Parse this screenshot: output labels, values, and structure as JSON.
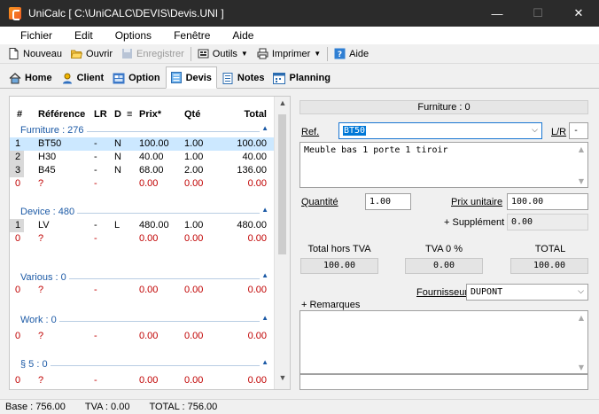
{
  "window": {
    "title": "UniCalc [ C:\\UniCALC\\DEVIS\\Devis.UNI ]",
    "minimize": "—",
    "maximize": "☐",
    "close": "✕"
  },
  "menu": [
    "Fichier",
    "Edit",
    "Options",
    "Fenêtre",
    "Aide"
  ],
  "toolbar": {
    "nouveau": "Nouveau",
    "ouvrir": "Ouvrir",
    "enregistrer": "Enregistrer",
    "outils": "Outils",
    "imprimer": "Imprimer",
    "aide": "Aide"
  },
  "tabs": [
    "Home",
    "Client",
    "Option",
    "Devis",
    "Notes",
    "Planning"
  ],
  "active_tab": "Devis",
  "grid": {
    "headers": {
      "num": "#",
      "ref": "Référence",
      "lr": "LR",
      "d": "D",
      "u": "≡",
      "prix": "Prix*",
      "qte": "Qté",
      "total": "Total"
    },
    "groups": [
      {
        "name": "Furniture : 276",
        "rows": [
          {
            "num": "1",
            "ref": "BT50",
            "lr": "-",
            "d": "N",
            "prix": "100.00",
            "qte": "1.00",
            "total": "100.00",
            "selected": true
          },
          {
            "num": "2",
            "ref": "H30",
            "lr": "-",
            "d": "N",
            "prix": "40.00",
            "qte": "1.00",
            "total": "40.00"
          },
          {
            "num": "3",
            "ref": "B45",
            "lr": "-",
            "d": "N",
            "prix": "68.00",
            "qte": "2.00",
            "total": "136.00"
          },
          {
            "num": "0",
            "ref": "?",
            "lr": "-",
            "d": "",
            "prix": "0.00",
            "qte": "0.00",
            "total": "0.00",
            "new": true
          }
        ]
      },
      {
        "name": "Device : 480",
        "rows": [
          {
            "num": "1",
            "ref": "LV",
            "lr": "-",
            "d": "L",
            "prix": "480.00",
            "qte": "1.00",
            "total": "480.00"
          },
          {
            "num": "0",
            "ref": "?",
            "lr": "-",
            "d": "",
            "prix": "0.00",
            "qte": "0.00",
            "total": "0.00",
            "new": true
          }
        ]
      },
      {
        "name": "Various : 0",
        "rows": [
          {
            "num": "0",
            "ref": "?",
            "lr": "-",
            "d": "",
            "prix": "0.00",
            "qte": "0.00",
            "total": "0.00",
            "new": true
          }
        ]
      },
      {
        "name": "Work : 0",
        "rows": [
          {
            "num": "0",
            "ref": "?",
            "lr": "-",
            "d": "",
            "prix": "0.00",
            "qte": "0.00",
            "total": "0.00",
            "new": true
          }
        ]
      },
      {
        "name": "§ 5 : 0",
        "rows": [
          {
            "num": "0",
            "ref": "?",
            "lr": "-",
            "d": "",
            "prix": "0.00",
            "qte": "0.00",
            "total": "0.00",
            "new": true
          }
        ]
      }
    ]
  },
  "detail": {
    "section_title": "Furniture : 0",
    "ref_label": "Ref.",
    "ref_value": "BT50",
    "lr_label": "L/R",
    "lr_value": "-",
    "description": "Meuble bas 1 porte 1 tiroir",
    "quantite_label": "Quantité",
    "quantite_value": "1.00",
    "prix_label": "Prix unitaire",
    "prix_value": "100.00",
    "supplement_label": "+ Supplément",
    "supplement_value": "0.00",
    "total_ht_label": "Total hors TVA",
    "total_ht_value": "100.00",
    "tva_label": "TVA 0 %",
    "tva_value": "0.00",
    "total_label": "TOTAL",
    "total_value": "100.00",
    "fournisseur_label": "Fournisseur",
    "fournisseur_value": "DUPONT",
    "remarques_label": "+ Remarques",
    "remarques_value": "",
    "bottom_field_value": ""
  },
  "status": {
    "base": "Base : 756.00",
    "tva": "TVA : 0.00",
    "total": "TOTAL : 756.00"
  }
}
